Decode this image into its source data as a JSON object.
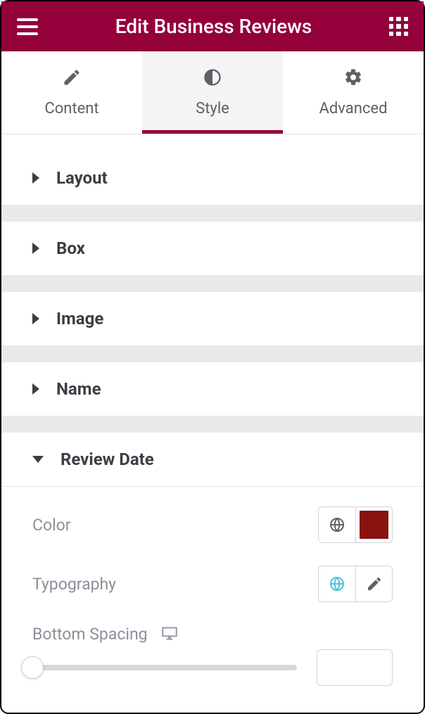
{
  "header": {
    "title": "Edit Business Reviews"
  },
  "tabs": {
    "content": "Content",
    "style": "Style",
    "advanced": "Advanced",
    "active": "style"
  },
  "sections": {
    "layout": "Layout",
    "box": "Box",
    "image": "Image",
    "name": "Name",
    "reviewDate": "Review Date"
  },
  "controls": {
    "color": {
      "label": "Color",
      "swatch": "#8a1310"
    },
    "typography": {
      "label": "Typography"
    },
    "bottomSpacing": {
      "label": "Bottom Spacing",
      "value": ""
    }
  }
}
